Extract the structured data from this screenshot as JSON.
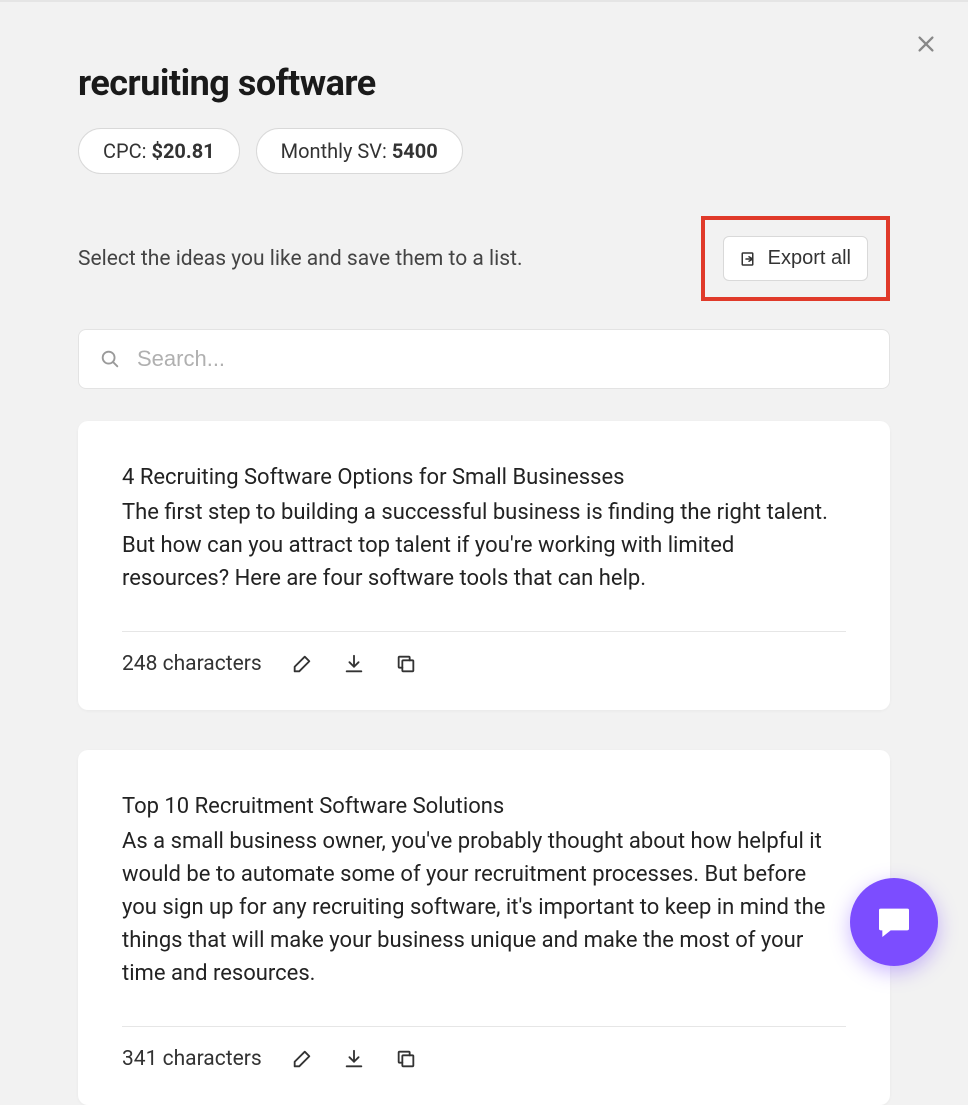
{
  "header": {
    "title": "recruiting software",
    "cpc_label": "CPC: ",
    "cpc_value": "$20.81",
    "sv_label": "Monthly SV: ",
    "sv_value": "5400"
  },
  "instruction": "Select the ideas you like and save them to a list.",
  "export_label": "Export all",
  "search": {
    "placeholder": "Search..."
  },
  "cards": [
    {
      "title": "4 Recruiting Software Options for Small Businesses",
      "body": "The first step to building a successful business is finding the right talent. But how can you attract top talent if you're working with limited resources? Here are four software tools that can help.",
      "char_count": "248 characters"
    },
    {
      "title": "Top 10 Recruitment Software Solutions",
      "body": "As a small business owner, you've probably thought about how helpful it would be to automate some of your recruitment processes. But before you sign up for any recruiting software, it's important to keep in mind the things that will make your business unique and make the most of your time and resources.",
      "char_count": "341 characters"
    }
  ],
  "icons": {
    "close": "close-icon",
    "search": "search-icon",
    "export": "export-icon",
    "edit": "pencil-icon",
    "download": "download-icon",
    "copy": "copy-icon",
    "chat": "chat-icon"
  }
}
